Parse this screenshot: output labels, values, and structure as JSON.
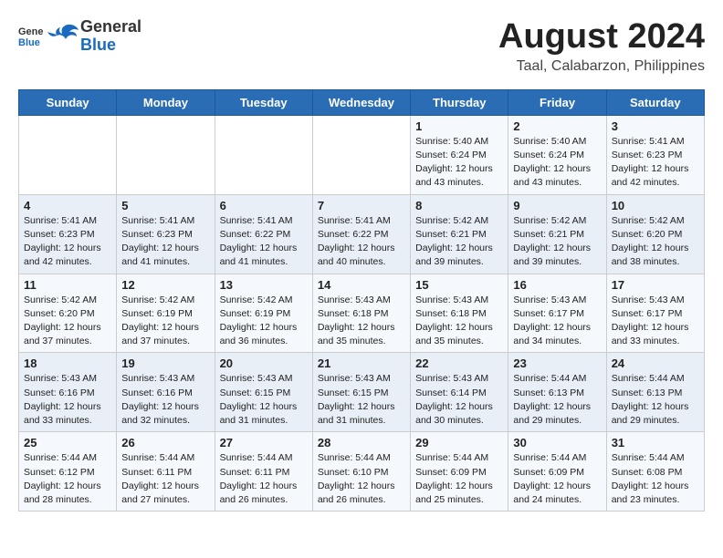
{
  "header": {
    "logo_general": "General",
    "logo_blue": "Blue",
    "month_year": "August 2024",
    "location": "Taal, Calabarzon, Philippines"
  },
  "weekdays": [
    "Sunday",
    "Monday",
    "Tuesday",
    "Wednesday",
    "Thursday",
    "Friday",
    "Saturday"
  ],
  "weeks": [
    [
      {
        "day": "",
        "info": ""
      },
      {
        "day": "",
        "info": ""
      },
      {
        "day": "",
        "info": ""
      },
      {
        "day": "",
        "info": ""
      },
      {
        "day": "1",
        "info": "Sunrise: 5:40 AM\nSunset: 6:24 PM\nDaylight: 12 hours\nand 43 minutes."
      },
      {
        "day": "2",
        "info": "Sunrise: 5:40 AM\nSunset: 6:24 PM\nDaylight: 12 hours\nand 43 minutes."
      },
      {
        "day": "3",
        "info": "Sunrise: 5:41 AM\nSunset: 6:23 PM\nDaylight: 12 hours\nand 42 minutes."
      }
    ],
    [
      {
        "day": "4",
        "info": "Sunrise: 5:41 AM\nSunset: 6:23 PM\nDaylight: 12 hours\nand 42 minutes."
      },
      {
        "day": "5",
        "info": "Sunrise: 5:41 AM\nSunset: 6:23 PM\nDaylight: 12 hours\nand 41 minutes."
      },
      {
        "day": "6",
        "info": "Sunrise: 5:41 AM\nSunset: 6:22 PM\nDaylight: 12 hours\nand 41 minutes."
      },
      {
        "day": "7",
        "info": "Sunrise: 5:41 AM\nSunset: 6:22 PM\nDaylight: 12 hours\nand 40 minutes."
      },
      {
        "day": "8",
        "info": "Sunrise: 5:42 AM\nSunset: 6:21 PM\nDaylight: 12 hours\nand 39 minutes."
      },
      {
        "day": "9",
        "info": "Sunrise: 5:42 AM\nSunset: 6:21 PM\nDaylight: 12 hours\nand 39 minutes."
      },
      {
        "day": "10",
        "info": "Sunrise: 5:42 AM\nSunset: 6:20 PM\nDaylight: 12 hours\nand 38 minutes."
      }
    ],
    [
      {
        "day": "11",
        "info": "Sunrise: 5:42 AM\nSunset: 6:20 PM\nDaylight: 12 hours\nand 37 minutes."
      },
      {
        "day": "12",
        "info": "Sunrise: 5:42 AM\nSunset: 6:19 PM\nDaylight: 12 hours\nand 37 minutes."
      },
      {
        "day": "13",
        "info": "Sunrise: 5:42 AM\nSunset: 6:19 PM\nDaylight: 12 hours\nand 36 minutes."
      },
      {
        "day": "14",
        "info": "Sunrise: 5:43 AM\nSunset: 6:18 PM\nDaylight: 12 hours\nand 35 minutes."
      },
      {
        "day": "15",
        "info": "Sunrise: 5:43 AM\nSunset: 6:18 PM\nDaylight: 12 hours\nand 35 minutes."
      },
      {
        "day": "16",
        "info": "Sunrise: 5:43 AM\nSunset: 6:17 PM\nDaylight: 12 hours\nand 34 minutes."
      },
      {
        "day": "17",
        "info": "Sunrise: 5:43 AM\nSunset: 6:17 PM\nDaylight: 12 hours\nand 33 minutes."
      }
    ],
    [
      {
        "day": "18",
        "info": "Sunrise: 5:43 AM\nSunset: 6:16 PM\nDaylight: 12 hours\nand 33 minutes."
      },
      {
        "day": "19",
        "info": "Sunrise: 5:43 AM\nSunset: 6:16 PM\nDaylight: 12 hours\nand 32 minutes."
      },
      {
        "day": "20",
        "info": "Sunrise: 5:43 AM\nSunset: 6:15 PM\nDaylight: 12 hours\nand 31 minutes."
      },
      {
        "day": "21",
        "info": "Sunrise: 5:43 AM\nSunset: 6:15 PM\nDaylight: 12 hours\nand 31 minutes."
      },
      {
        "day": "22",
        "info": "Sunrise: 5:43 AM\nSunset: 6:14 PM\nDaylight: 12 hours\nand 30 minutes."
      },
      {
        "day": "23",
        "info": "Sunrise: 5:44 AM\nSunset: 6:13 PM\nDaylight: 12 hours\nand 29 minutes."
      },
      {
        "day": "24",
        "info": "Sunrise: 5:44 AM\nSunset: 6:13 PM\nDaylight: 12 hours\nand 29 minutes."
      }
    ],
    [
      {
        "day": "25",
        "info": "Sunrise: 5:44 AM\nSunset: 6:12 PM\nDaylight: 12 hours\nand 28 minutes."
      },
      {
        "day": "26",
        "info": "Sunrise: 5:44 AM\nSunset: 6:11 PM\nDaylight: 12 hours\nand 27 minutes."
      },
      {
        "day": "27",
        "info": "Sunrise: 5:44 AM\nSunset: 6:11 PM\nDaylight: 12 hours\nand 26 minutes."
      },
      {
        "day": "28",
        "info": "Sunrise: 5:44 AM\nSunset: 6:10 PM\nDaylight: 12 hours\nand 26 minutes."
      },
      {
        "day": "29",
        "info": "Sunrise: 5:44 AM\nSunset: 6:09 PM\nDaylight: 12 hours\nand 25 minutes."
      },
      {
        "day": "30",
        "info": "Sunrise: 5:44 AM\nSunset: 6:09 PM\nDaylight: 12 hours\nand 24 minutes."
      },
      {
        "day": "31",
        "info": "Sunrise: 5:44 AM\nSunset: 6:08 PM\nDaylight: 12 hours\nand 23 minutes."
      }
    ]
  ]
}
